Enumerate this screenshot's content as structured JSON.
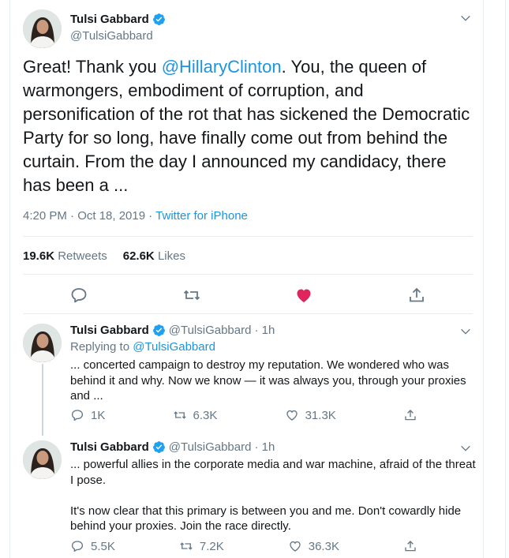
{
  "main_tweet": {
    "author_name": "Tulsi Gabbard",
    "handle": "@TulsiGabbard",
    "text_before": "Great! Thank you ",
    "mention": "@HillaryClinton",
    "text_after": ". You, the queen of warmongers, embodiment of corruption, and personification of the rot that has sickened the Democratic Party for so long, have finally come out from behind the curtain. From the day I announced my candidacy, there has been a ...",
    "time": "4:20 PM · Oct 18, 2019 · ",
    "source": "Twitter for iPhone",
    "retweets_count": "19.6K",
    "retweets_label": "Retweets",
    "likes_count": "62.6K",
    "likes_label": "Likes"
  },
  "replies": [
    {
      "author_name": "Tulsi Gabbard",
      "handle": "@TulsiGabbard",
      "time": "· 1h",
      "replying_label": "Replying to ",
      "replying_to": "@TulsiGabbard",
      "text": "... concerted campaign to destroy my reputation. We wondered who was behind it and why. Now we know — it was always you, through your proxies and ...",
      "reply_count": "1K",
      "retweet_count": "6.3K",
      "like_count": "31.3K"
    },
    {
      "author_name": "Tulsi Gabbard",
      "handle": "@TulsiGabbard",
      "time": "· 1h",
      "text": "... powerful allies in the corporate media and war machine, afraid of the threat I pose.\n\nIt's now clear that this primary is between you and me. Don't cowardly hide behind your proxies. Join the race directly.",
      "reply_count": "5.5K",
      "retweet_count": "7.2K",
      "like_count": "36.3K"
    }
  ],
  "colors": {
    "link": "#1b95e0",
    "muted": "#657786",
    "like_active": "#e0245e",
    "verified": "#1da1f2"
  },
  "icons": [
    "verified-badge-icon",
    "chevron-down-icon",
    "reply-icon",
    "retweet-icon",
    "heart-icon",
    "share-icon"
  ]
}
